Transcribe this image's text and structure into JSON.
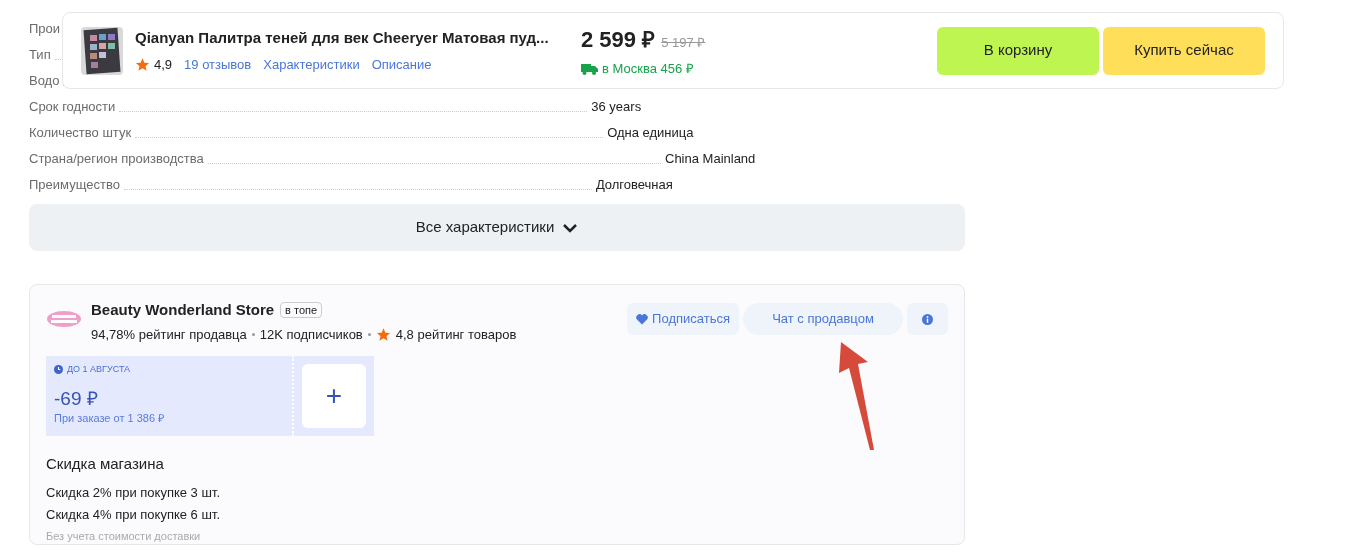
{
  "specs": [
    {
      "label": "Прои"
    },
    {
      "label": "Тип"
    },
    {
      "label": "Водо"
    },
    {
      "label": "Срок годности",
      "value": "36 years"
    },
    {
      "label": "Количество штук",
      "value": "Одна единица"
    },
    {
      "label": "Страна/регион производства",
      "value": "China Mainland"
    },
    {
      "label": "Преимущество",
      "value": "Долговечная"
    }
  ],
  "all_specs_button": "Все характеристики",
  "sticky_header": {
    "title": "Qianyan Палитра теней для век Cheeryer Матовая пуд...",
    "rating": "4,9",
    "links": [
      "19 отзывов",
      "Характеристики",
      "Описание"
    ],
    "price": "2 599 ₽",
    "old_price": "5 197 ₽",
    "delivery": "в Москва 456 ₽",
    "buttons": [
      {
        "label": "В корзину",
        "kind": "cart"
      },
      {
        "label": "Купить сейчас",
        "kind": "buy"
      }
    ]
  },
  "store": {
    "name": "Beauty Wonderland Store",
    "badge": "в топе",
    "stats": [
      "94,78% рейтинг продавца",
      "12K подписчиков"
    ],
    "product_rating": "4,8 рейтинг товаров",
    "actions": [
      {
        "label": "Подписаться",
        "kind": "subscribe"
      },
      {
        "label": "Чат с продавцом",
        "kind": "chat"
      },
      {
        "kind": "info"
      }
    ],
    "coupon": {
      "deadline": "ДО 1 АВГУСТА",
      "amount": "-69 ₽",
      "condition": "При заказе от 1 386 ₽",
      "add": "+"
    },
    "discount_title": "Скидка магазина",
    "discounts": [
      "Скидка 2% при покупке 3 шт.",
      "Скидка 4% при покупке 6 шт."
    ],
    "note": "Без учета стоимости доставки"
  }
}
